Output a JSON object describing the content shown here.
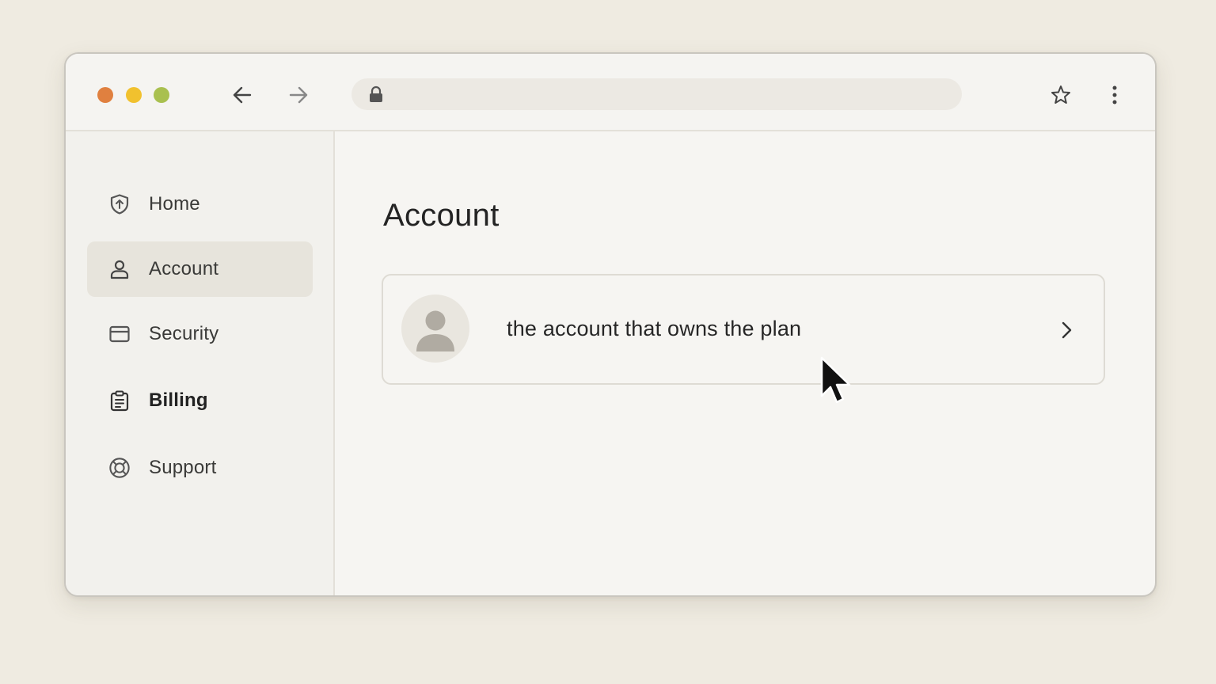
{
  "window": {
    "controls": {
      "close_color": "#e0803f",
      "minimize_color": "#f1c12e",
      "zoom_color": "#a9c04f"
    },
    "address_bar": {
      "url": ""
    }
  },
  "sidebar": {
    "items": [
      {
        "label": "Home",
        "icon": "shield-icon",
        "active": false
      },
      {
        "label": "Account",
        "icon": "user-icon",
        "active": true
      },
      {
        "label": "Security",
        "icon": "card-icon",
        "active": false
      },
      {
        "label": "Billing",
        "icon": "clipboard-icon",
        "active": false
      },
      {
        "label": "Support",
        "icon": "lifebuoy-icon",
        "active": false
      }
    ]
  },
  "main": {
    "title": "Account",
    "card": {
      "text": "the account that owns the plan"
    }
  },
  "colors": {
    "background": "#efebe1",
    "window_bg": "#f6f5f2",
    "sidebar_active_bg": "#e7e4dc",
    "text_primary": "#242424"
  }
}
